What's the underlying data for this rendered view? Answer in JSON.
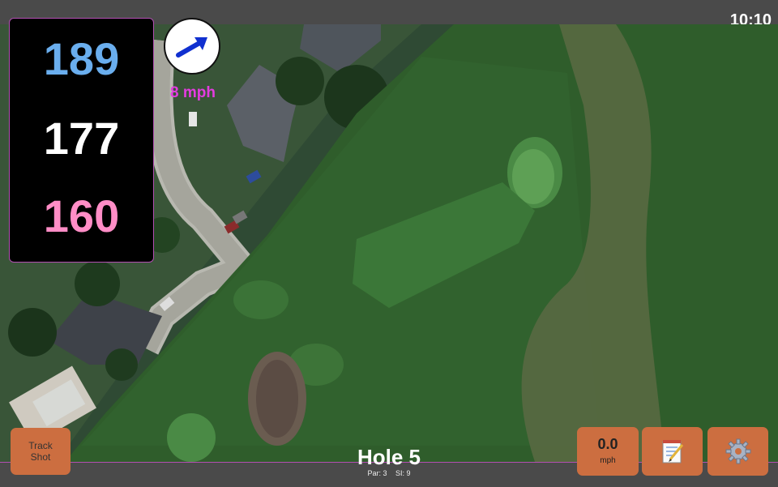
{
  "status": {
    "time": "10:10"
  },
  "distances": {
    "back": "189",
    "middle": "177",
    "front": "160"
  },
  "wind": {
    "speed_label": "8 mph",
    "icon": "wind-arrow-icon"
  },
  "buttons": {
    "track_shot_line1": "Track",
    "track_shot_line2": "Shot",
    "speed_value": "0.0",
    "speed_unit": "mph",
    "notes_icon": "notepad-icon",
    "settings_icon": "gear-icon"
  },
  "hole": {
    "title": "Hole 5",
    "par": "Par: 3",
    "si": "SI: 9"
  },
  "colors": {
    "accent_border": "#b24fb2",
    "button": "#cc6e40",
    "back": "#6aaeee",
    "front": "#ff8dc6",
    "wind_text": "#e33ce0"
  }
}
